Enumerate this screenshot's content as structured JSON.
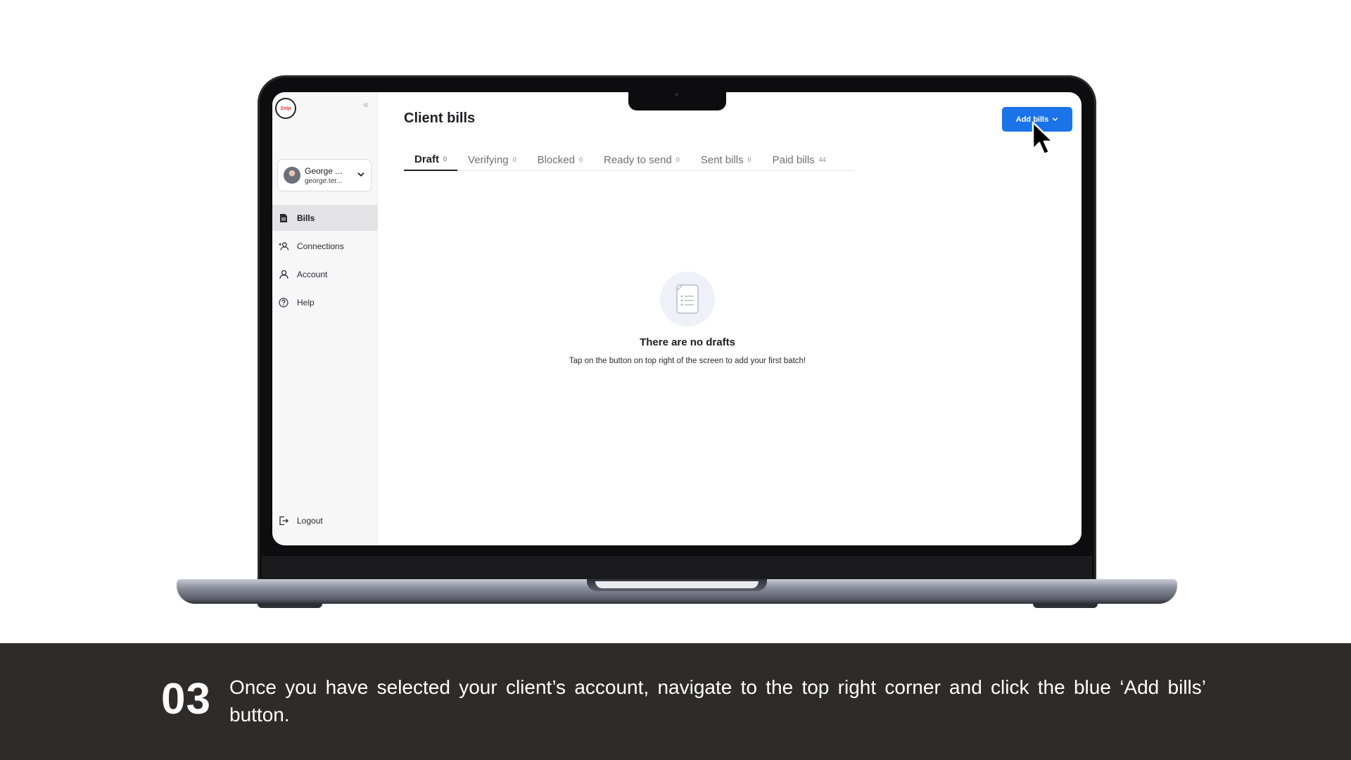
{
  "app": {
    "logo_text": "Snip",
    "user": {
      "name": "George ...",
      "email": "george.ter..."
    },
    "nav": [
      {
        "label": "Bills",
        "icon": "document-icon",
        "active": true
      },
      {
        "label": "Connections",
        "icon": "add-user-icon",
        "active": false
      },
      {
        "label": "Account",
        "icon": "user-icon",
        "active": false
      },
      {
        "label": "Help",
        "icon": "help-circle-icon",
        "active": false
      }
    ],
    "logout_label": "Logout",
    "page_title": "Client bills",
    "add_button_label": "Add bills",
    "tabs": [
      {
        "label": "Draft",
        "count": "0",
        "active": true
      },
      {
        "label": "Verifying",
        "count": "0"
      },
      {
        "label": "Blocked",
        "count": "0"
      },
      {
        "label": "Ready to send",
        "count": "0"
      },
      {
        "label": "Sent bills",
        "count": "0"
      },
      {
        "label": "Paid bills",
        "count": "44"
      }
    ],
    "empty_state": {
      "title": "There are no drafts",
      "subtitle": "Tap on the button on top right of the screen to add your first batch!"
    },
    "accent_color": "#1a73e8"
  },
  "caption": {
    "step_number": "03",
    "text": "Once you have selected your client’s account, navigate to the top right corner and click the blue ‘Add bills’ button."
  }
}
